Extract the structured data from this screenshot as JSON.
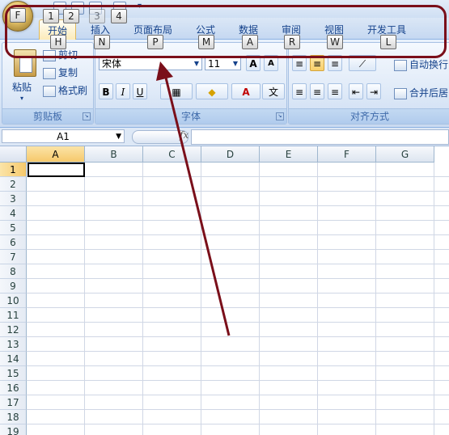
{
  "keytips": {
    "office": "F",
    "qat": [
      "1",
      "2",
      "3",
      "4"
    ],
    "tabs": [
      "H",
      "N",
      "P",
      "M",
      "A",
      "R",
      "W",
      "L"
    ]
  },
  "tabs": [
    "开始",
    "插入",
    "页面布局",
    "公式",
    "数据",
    "审阅",
    "视图",
    "开发工具"
  ],
  "clipboard": {
    "paste": "粘贴",
    "cut": "剪切",
    "copy": "复制",
    "format_painter": "格式刷",
    "label": "剪贴板"
  },
  "font": {
    "name": "宋体",
    "size": "11",
    "grow": "A",
    "shrink": "A",
    "bold": "B",
    "italic": "I",
    "underline": "U",
    "font_color": "A",
    "phonetic": "文",
    "label": "字体"
  },
  "alignment": {
    "wrap_text": "自动换行",
    "merge_center": "合并后居",
    "label": "对齐方式"
  },
  "formula_bar": {
    "name_box": "A1",
    "fx": "fx"
  },
  "grid": {
    "columns": [
      "A",
      "B",
      "C",
      "D",
      "E",
      "F",
      "G"
    ],
    "rows": [
      "1",
      "2",
      "3",
      "4",
      "5",
      "6",
      "7",
      "8",
      "9",
      "10",
      "11",
      "12",
      "13",
      "14",
      "15",
      "16",
      "17",
      "18",
      "19"
    ]
  },
  "colors": {
    "annotation": "#7a0f1a",
    "ribbon": "#dbe7f7",
    "selection": "#f6c96b"
  }
}
